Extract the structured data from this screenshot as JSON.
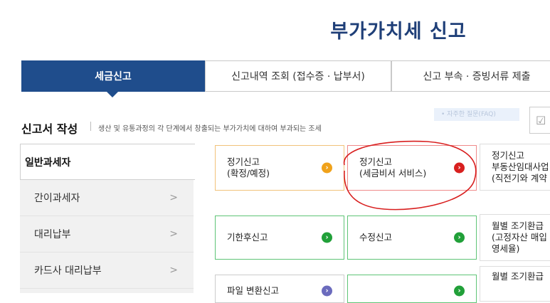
{
  "page_title": "부가가치세 신고",
  "tabs": [
    {
      "label": "세금신고"
    },
    {
      "label": "신고내역 조회 (접수증 · 납부서)"
    },
    {
      "label": "신고 부속 · 증빙서류 제출"
    }
  ],
  "section": {
    "title": "신고서 작성",
    "desc": "생산 및 유통과정의 각 단계에서 창출되는 부가가치에 대하여 부과되는 조세",
    "search_hint": "• 자주한 질문(FAQ)",
    "corner_icon": "☑"
  },
  "sidebar": {
    "items": [
      {
        "label": "일반과세자",
        "chevron": ""
      },
      {
        "label": "간이과세자",
        "chevron": ">"
      },
      {
        "label": "대리납부",
        "chevron": ">"
      },
      {
        "label": "카드사 대리납부",
        "chevron": ">"
      }
    ]
  },
  "cards": [
    {
      "label": "정기신고\n(확정/예정)",
      "go": "›"
    },
    {
      "label": "정기신고\n(세금비서 서비스)",
      "go": "›"
    },
    {
      "label": "정기신고\n부동산임대사업\n(직전기와 계약",
      "go": ""
    },
    {
      "label": "기한후신고",
      "go": "›"
    },
    {
      "label": "수정신고",
      "go": "›"
    },
    {
      "label": "월별 조기환급\n(고정자산 매입\n영세율)",
      "go": ""
    },
    {
      "label": "파일 변환신고",
      "go": "›"
    },
    {
      "label": "",
      "go": "›"
    },
    {
      "label": "월별 조기환급",
      "go": ""
    }
  ],
  "colors": {
    "brand_blue": "#1f4d8c",
    "title_blue": "#1f3f78",
    "orange": "#f0a21b",
    "red": "#d8201f",
    "green": "#21a039",
    "annotation_red": "#d81e1e"
  }
}
